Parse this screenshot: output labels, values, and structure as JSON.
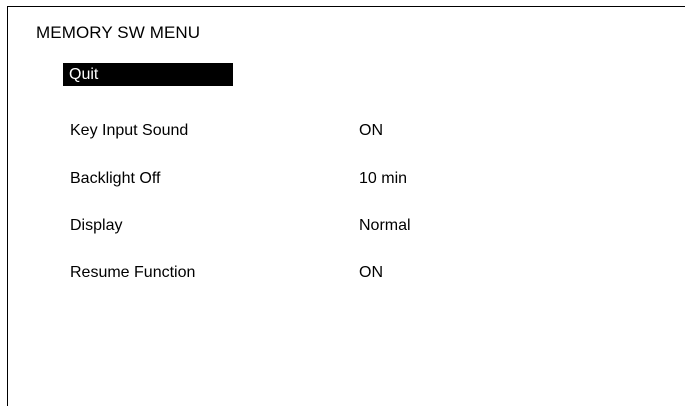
{
  "menu": {
    "title": "MEMORY SW MENU",
    "quit_label": "Quit",
    "settings": [
      {
        "label": "Key Input Sound",
        "value": "ON"
      },
      {
        "label": "Backlight Off",
        "value": "10 min"
      },
      {
        "label": "Display",
        "value": "Normal"
      },
      {
        "label": "Resume Function",
        "value": "ON"
      }
    ]
  },
  "colors": {
    "background": "#ffffff",
    "text": "#000000",
    "highlight_background": "#000000",
    "highlight_text": "#ffffff"
  }
}
